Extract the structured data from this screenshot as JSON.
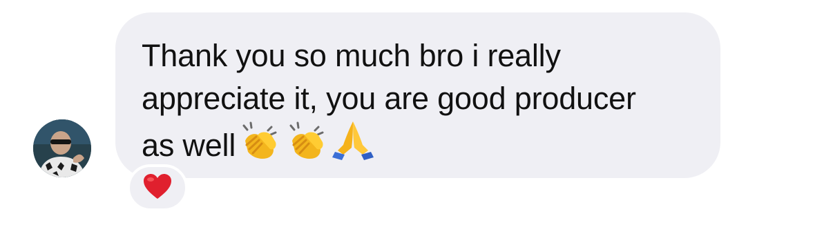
{
  "message": {
    "lines": [
      "Thank you so much bro i really",
      "appreciate it, you are good producer",
      "as well"
    ],
    "trailing_emojis": [
      "clapping-hands",
      "clapping-hands",
      "folded-hands"
    ]
  },
  "reaction": {
    "emoji": "red-heart"
  },
  "colors": {
    "bubble_bg": "#efeff4",
    "text": "#111111",
    "heart": "#e0202e"
  }
}
